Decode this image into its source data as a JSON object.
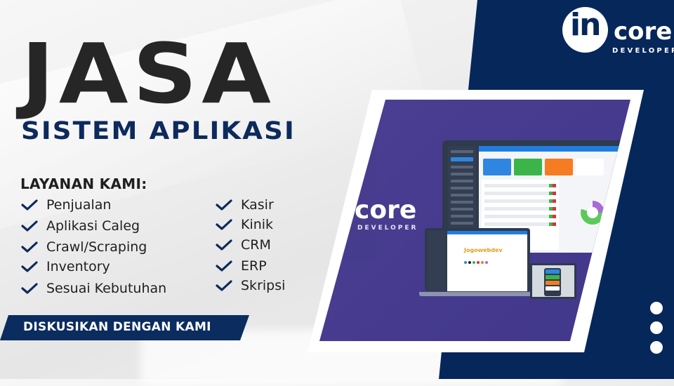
{
  "headline": {
    "title": "JASA",
    "subtitle": "SISTEM APLIKASI"
  },
  "services": {
    "heading": "LAYANAN KAMI:",
    "left_column": [
      "Penjualan",
      "Aplikasi Caleg",
      "Crawl/Scraping",
      "Inventory",
      "Sesuai Kebutuhan"
    ],
    "right_column": [
      "Kasir",
      "Kinik",
      "CRM",
      "ERP",
      "Skripsi"
    ],
    "bullet_icon": "checkmark-icon"
  },
  "cta": {
    "label": "DISKUSIKAN DENGAN KAMI"
  },
  "brand": {
    "logo_mark": "in",
    "name": "core",
    "tagline": "DEVELOPER"
  },
  "mockup": {
    "brand_name": "core",
    "brand_tagline": "DEVELOPER",
    "app_logo": "Jogowebdev"
  },
  "decor": {
    "dots_icon": "vertical-dots-icon"
  },
  "colors": {
    "navy": "#06275a",
    "cta_navy": "#0b2c5f",
    "purple": "#4b3f93",
    "title_dark": "#262626",
    "subtitle_navy": "#0d2a5c",
    "white": "#ffffff"
  }
}
